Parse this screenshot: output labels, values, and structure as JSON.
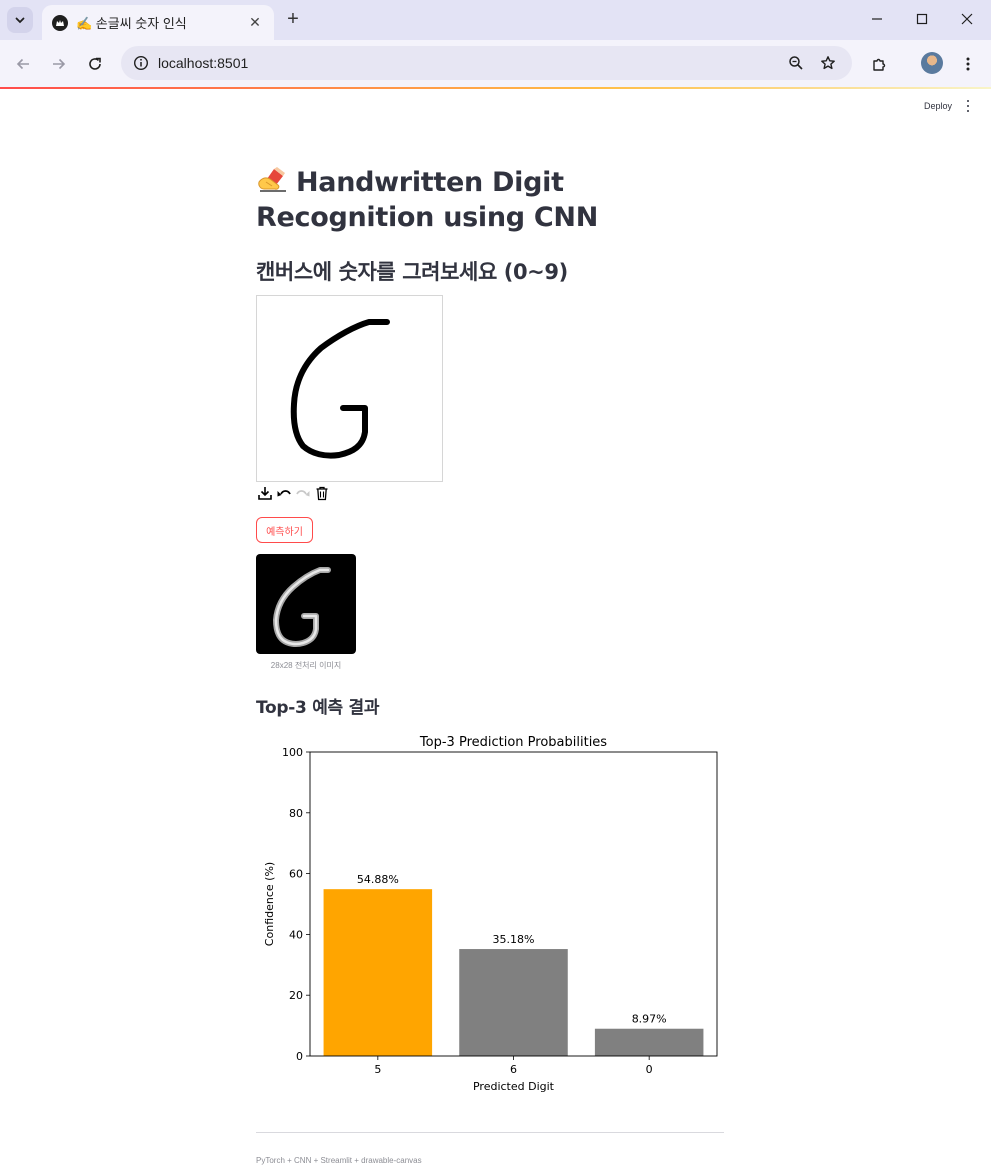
{
  "browser": {
    "tab_title": "✍️ 손글씨 숫자 인식",
    "url": "localhost:8501"
  },
  "app": {
    "deploy_label": "Deploy",
    "title": "Handwritten Digit Recognition using CNN",
    "title_emoji": "writing-hand-icon",
    "subheader": "캔버스에 숫자를 그려보세요 (0~9)",
    "predict_button": "예측하기",
    "processed_caption": "28x28 전처리 이미지",
    "results_title": "Top-3 예측 결과",
    "footer": "PyTorch + CNN + Streamlit + drawable-canvas",
    "canvas_tools": [
      "download-icon",
      "undo-icon",
      "redo-icon",
      "trash-icon"
    ]
  },
  "colors": {
    "accent": "#ff4b4b",
    "top_bar": "#ffa500",
    "other_bars": "#808080"
  },
  "chart_data": {
    "type": "bar",
    "title": "Top-3 Prediction Probabilities",
    "xlabel": "Predicted Digit",
    "ylabel": "Confidence (%)",
    "categories": [
      "5",
      "6",
      "0"
    ],
    "values": [
      54.88,
      35.18,
      8.97
    ],
    "value_labels": [
      "54.88%",
      "35.18%",
      "8.97%"
    ],
    "colors": [
      "#ffa500",
      "#808080",
      "#808080"
    ],
    "ylim": [
      0,
      100
    ],
    "yticks": [
      0,
      20,
      40,
      60,
      80,
      100
    ],
    "grid": false,
    "legend": "none"
  }
}
